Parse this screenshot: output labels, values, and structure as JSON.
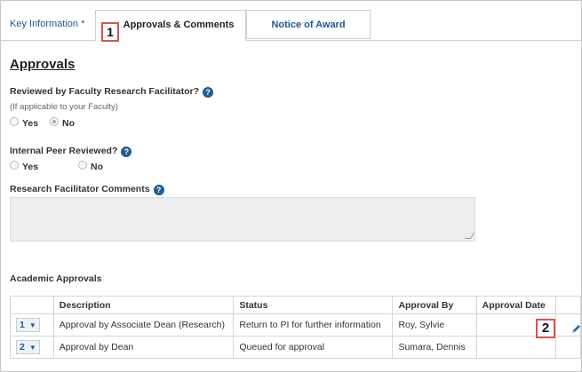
{
  "tabs": {
    "key_information": "Key Information *",
    "approvals_comments": "Approvals & Comments",
    "notice_of_award": "Notice of Award"
  },
  "callouts": {
    "one": "1",
    "two": "2"
  },
  "approvals": {
    "title": "Approvals",
    "faculty_question": "Reviewed by Faculty Research Facilitator?",
    "faculty_note": "(If applicable to your Faculty)",
    "faculty_options": {
      "yes": "Yes",
      "no": "No",
      "selected": "No"
    },
    "peer_question": "Internal Peer Reviewed?",
    "peer_options": {
      "yes": "Yes",
      "no": "No",
      "selected": ""
    },
    "comments_label": "Research Facilitator Comments",
    "comments_value": ""
  },
  "academic_approvals": {
    "title": "Academic Approvals",
    "columns": [
      "Description",
      "Status",
      "Approval By",
      "Approval Date"
    ],
    "rows": [
      {
        "num": "1",
        "description": "Approval by Associate Dean (Research)",
        "status": "Return to PI for further information",
        "approval_by": "Roy, Sylvie",
        "approval_date": ""
      },
      {
        "num": "2",
        "description": "Approval by Dean",
        "status": "Queued for approval",
        "approval_by": "Sumara, Dennis",
        "approval_date": ""
      }
    ]
  },
  "icons": {
    "help": "question-circle-icon",
    "edit": "pencil-icon",
    "dropdown": "chevron-down-icon"
  },
  "colors": {
    "link": "#1a5a9a",
    "help_icon": "#1f5d8f",
    "callout_border": "#d9534f"
  }
}
